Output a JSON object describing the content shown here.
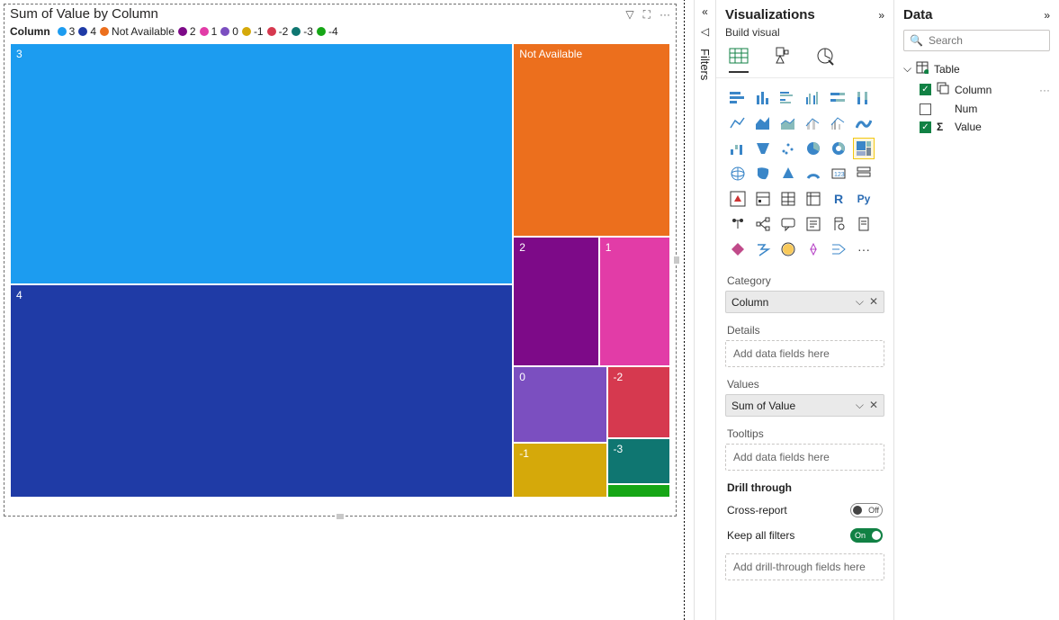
{
  "chart_data": {
    "type": "treemap",
    "title": "Sum of Value by Column",
    "legend_title": "Column",
    "series": [
      {
        "name": "3",
        "color": "#1c9cf0",
        "value": 150000
      },
      {
        "name": "4",
        "color": "#1f3ba6",
        "value": 130000
      },
      {
        "name": "Not Available",
        "color": "#ec6f1d",
        "value": 37000
      },
      {
        "name": "2",
        "color": "#7d0a88",
        "value": 14000
      },
      {
        "name": "1",
        "color": "#e23ca7",
        "value": 11000
      },
      {
        "name": "0",
        "color": "#7b4fc0",
        "value": 10000
      },
      {
        "name": "-1",
        "color": "#d5a90a",
        "value": 5000
      },
      {
        "name": "-2",
        "color": "#d6394f",
        "value": 5000
      },
      {
        "name": "-3",
        "color": "#0f7671",
        "value": 4000
      },
      {
        "name": "-4",
        "color": "#16a616",
        "value": 900
      }
    ]
  },
  "visual_actions": {
    "filter": "▽",
    "focus": "⛶",
    "more": "···"
  },
  "filters_panel": {
    "collapse": "«",
    "label": "Filters",
    "icon": "◁"
  },
  "viz_panel": {
    "title": "Visualizations",
    "expand": "»",
    "subtitle": "Build visual",
    "sections": {
      "category": {
        "label": "Category",
        "value": "Column"
      },
      "details": {
        "label": "Details",
        "placeholder": "Add data fields here"
      },
      "values": {
        "label": "Values",
        "value": "Sum of Value"
      },
      "tooltips": {
        "label": "Tooltips",
        "placeholder": "Add data fields here"
      }
    },
    "drill": {
      "title": "Drill through",
      "cross": "Cross-report",
      "cross_state": "Off",
      "keep": "Keep all filters",
      "keep_state": "On",
      "placeholder": "Add drill-through fields here"
    }
  },
  "data_panel": {
    "title": "Data",
    "expand": "»",
    "search_placeholder": "Search",
    "table": {
      "name": "Table",
      "fields": [
        {
          "name": "Column",
          "checked": true,
          "icon": "table"
        },
        {
          "name": "Num",
          "checked": false,
          "icon": ""
        },
        {
          "name": "Value",
          "checked": true,
          "icon": "sigma"
        }
      ]
    }
  }
}
